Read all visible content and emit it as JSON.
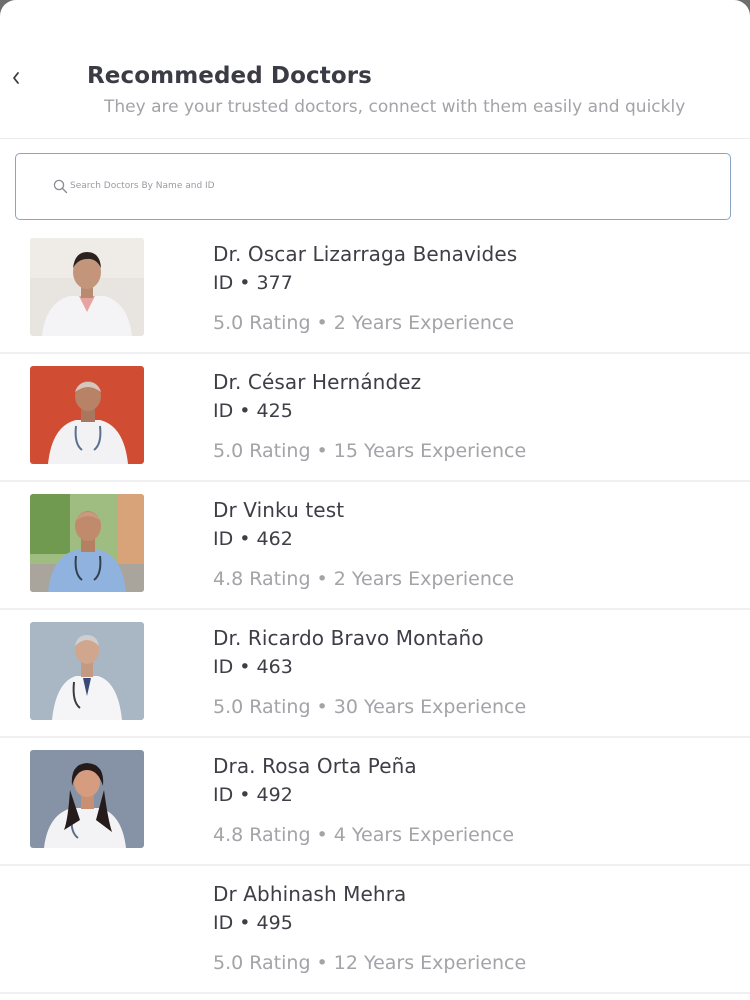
{
  "header": {
    "title": "Recommeded Doctors",
    "subtitle": "They are your trusted doctors, connect with them easily and quickly",
    "back_icon": "chevron-left-icon"
  },
  "search": {
    "icon": "search-icon",
    "placeholder": "Search Doctors By Name and ID",
    "value": ""
  },
  "doctors": [
    {
      "name": "Dr. Oscar Lizarraga Benavides",
      "id_text": "ID • 377",
      "meta": "5.0 Rating • 2 Years Experience",
      "photo_bg": "#e9e6e1",
      "has_photo": true
    },
    {
      "name": "Dr. César Hernández",
      "id_text": "ID • 425",
      "meta": "5.0 Rating • 15 Years Experience",
      "photo_bg": "#d24f36",
      "has_photo": true
    },
    {
      "name": "Dr Vinku test",
      "id_text": "ID • 462",
      "meta": "4.8 Rating • 2 Years Experience",
      "photo_bg": "#8fb070",
      "has_photo": true
    },
    {
      "name": "Dr. Ricardo Bravo Montaño",
      "id_text": "ID • 463",
      "meta": "5.0 Rating • 30 Years Experience",
      "photo_bg": "#a9b8c4",
      "has_photo": true
    },
    {
      "name": "Dra. Rosa Orta Peña",
      "id_text": "ID • 492",
      "meta": "4.8 Rating • 4 Years Experience",
      "photo_bg": "#8894a6",
      "has_photo": true
    },
    {
      "name": "Dr Abhinash Mehra",
      "id_text": "ID • 495",
      "meta": "5.0 Rating • 12 Years Experience",
      "photo_bg": "#ffffff",
      "has_photo": false
    }
  ]
}
